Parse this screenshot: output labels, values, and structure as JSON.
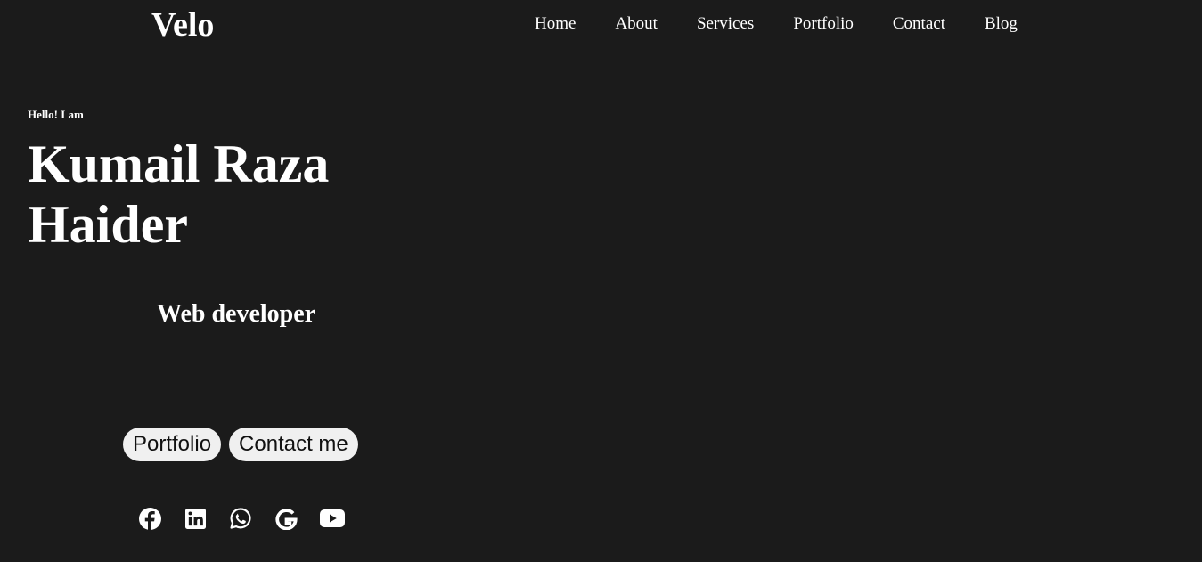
{
  "brand": {
    "logo": "Velo"
  },
  "nav": {
    "items": [
      {
        "label": "Home"
      },
      {
        "label": "About"
      },
      {
        "label": "Services"
      },
      {
        "label": "Portfolio"
      },
      {
        "label": "Contact"
      },
      {
        "label": "Blog"
      }
    ]
  },
  "hero": {
    "greeting": "Hello! I am",
    "name": "Kumail Raza Haider",
    "role": "Web developer",
    "buttons": {
      "portfolio": "Portfolio",
      "contact": "Contact me"
    }
  },
  "socials": [
    {
      "icon": "facebook-icon"
    },
    {
      "icon": "linkedin-icon"
    },
    {
      "icon": "whatsapp-icon"
    },
    {
      "icon": "google-icon"
    },
    {
      "icon": "youtube-icon"
    }
  ],
  "colors": {
    "background": "#1b1b1b",
    "text": "#ffffff",
    "button_bg": "#f0f0f0",
    "button_text": "#111111"
  }
}
